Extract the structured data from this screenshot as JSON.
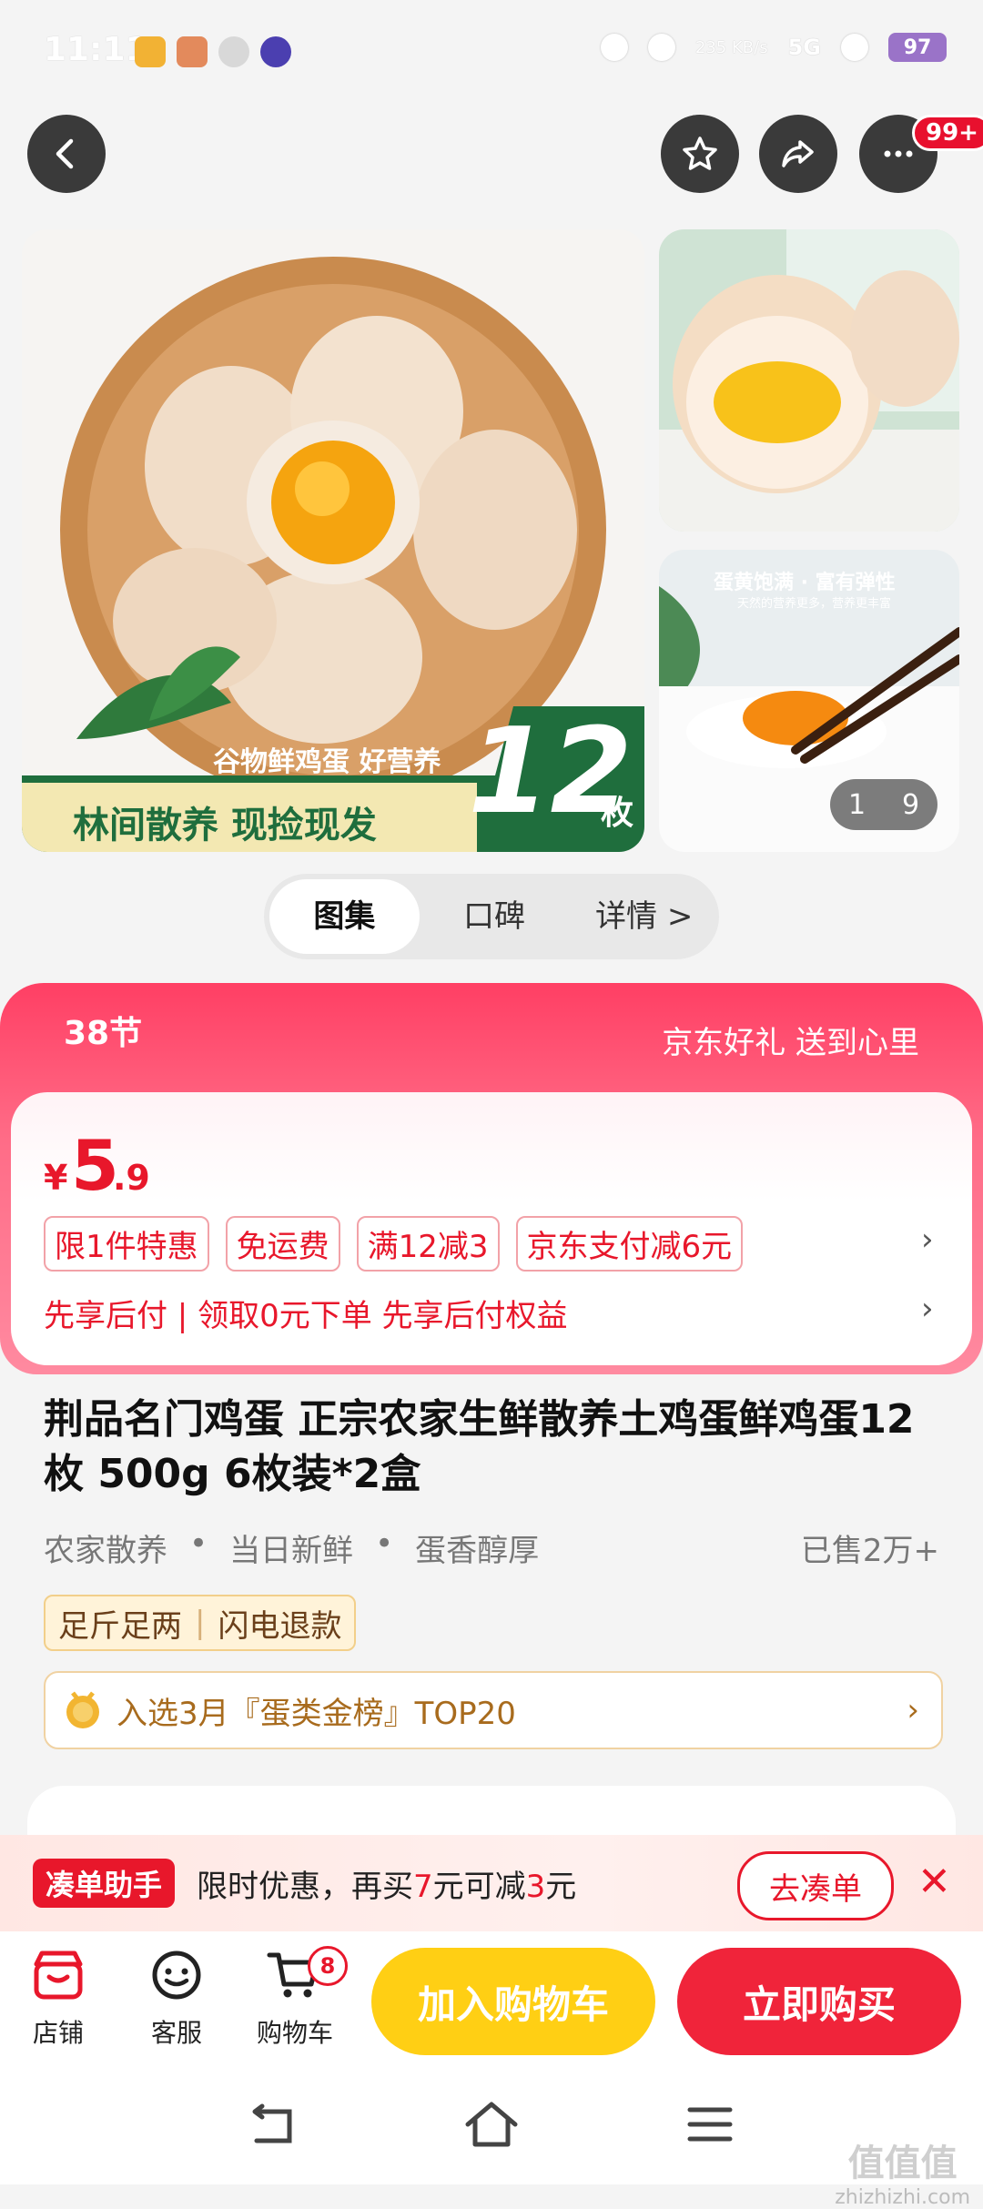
{
  "status_bar": {
    "time": "11:11",
    "net_speed": "235 KB/s",
    "signal": "5G",
    "battery": "97"
  },
  "top_nav": {
    "more_badge": "99+"
  },
  "gallery": {
    "main_image_caption_small": "谷物鲜鸡蛋 好营养",
    "main_image_caption_large": "林间散养 现捡现发",
    "main_image_count": "12",
    "main_image_count_unit": "枚",
    "side_image_caption": "蛋黄饱满 · 富有弹性",
    "side_image_subcaption": "天然的营养更多，营养更丰富",
    "counter_current": "1",
    "counter_total": "9"
  },
  "tabs": [
    {
      "label": "图集",
      "active": true
    },
    {
      "label": "口碑",
      "active": false
    },
    {
      "label": "详情 >",
      "active": false
    }
  ],
  "promo": {
    "festival_tag": "38节",
    "slogan": "京东好礼 送到心里",
    "price_symbol": "¥",
    "price_integer": "5",
    "price_decimal": ".9",
    "chips": [
      "限1件特惠",
      "免运费",
      "满12减3",
      "京东支付减6元"
    ],
    "pay_later": "先享后付 | 领取0元下单 先享后付权益"
  },
  "product": {
    "title": "荆品名门鸡蛋 正宗农家生鲜散养土鸡蛋鲜鸡蛋12枚 500g 6枚装*2盒",
    "attributes": [
      "农家散养",
      "当日新鲜",
      "蛋香醇厚"
    ],
    "sold": "已售2万+",
    "service_tags": [
      "足斤足两",
      "闪电退款"
    ],
    "ranking": "入选3月『蛋类金榜』TOP20"
  },
  "bundle_helper": {
    "tag": "凑单助手",
    "text_prefix": "限时优惠，再买",
    "amount_need": "7",
    "text_mid": "元可减",
    "amount_off": "3",
    "text_suffix": "元",
    "button": "去凑单"
  },
  "action_bar": {
    "store_label": "店铺",
    "service_label": "客服",
    "cart_label": "购物车",
    "cart_count": "8",
    "add_to_cart": "加入购物车",
    "buy_now": "立即购买"
  },
  "watermark": {
    "line1": "值值值",
    "line2": "zhizhizhi.com"
  },
  "colors": {
    "brand_red": "#e8172b",
    "add_cart_yellow": "#ffcf14",
    "buy_red": "#f0243a",
    "promo_pink": "#ff3f64"
  }
}
